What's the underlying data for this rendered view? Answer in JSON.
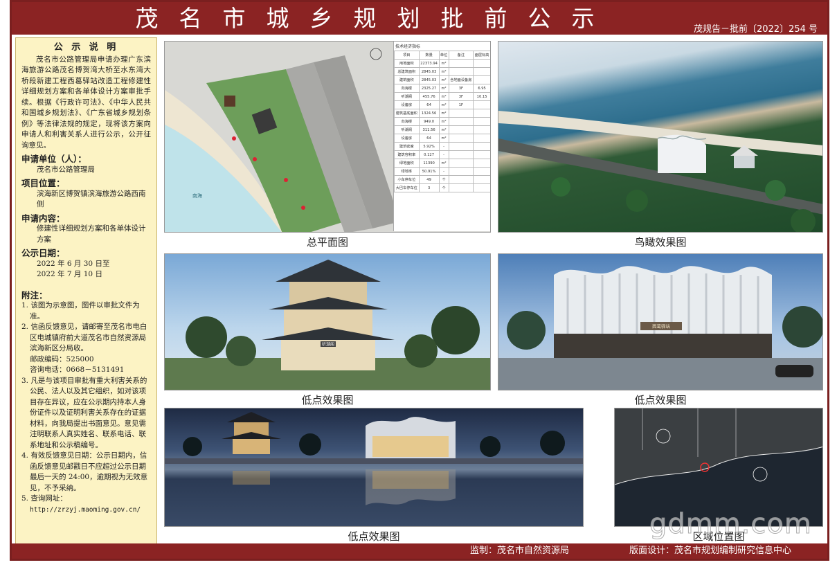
{
  "header": {
    "title": "茂名市城乡规划批前公示",
    "doc_number": "茂规告－批前〔2022〕254 号"
  },
  "notice": {
    "heading": "公 示 说 明",
    "text": "茂名市公路管理局申请办理广东滨海旅游公路茂名博贺湾大桥至水东湾大桥段新建工程西葛驿站改造工程修建性详细规划方案和各单体设计方案审批手续。根据《行政许可法》、《中华人民共和国城乡规划法》、《广东省城乡规划条例》等法律法规的规定，现将该方案向申请人和利害关系人进行公示，公开征询意见。",
    "applicant_label": "申请单位（人）：",
    "applicant": "茂名市公路管理局",
    "location_label": "项目位置：",
    "location": "滨海新区博贺镇滨海旅游公路西南侧",
    "content_label": "申请内容：",
    "content": "修建性详细规划方案和各单体设计方案",
    "date_label": "公示日期：",
    "date_from": "2022 年 6 月 30 日至",
    "date_to": "2022 年 7 月 10 日",
    "appendix_label": "附注：",
    "notes": [
      "1. 该图为示意图，图件以审批文件为准。",
      "2. 信函反馈意见，请邮寄至茂名市电白区电城镇府前大道茂名市自然资源局滨海新区分局收。",
      "邮政编码：525000",
      "咨询电话：0668－5131491",
      "3. 凡是与该项目审批有重大利害关系的公民、法人以及其它组织，如对该项目存在异议，应在公示期内持本人身份证件以及证明利害关系存在的证据材料，向我局提出书面意见。意见需注明联系人真实姓名、联系电话、联系地址和公示稿编号。",
      "4. 有效反馈意见日期：公示日期内，信函反馈意见邮戳日不应超过公示日期最后一天的 24:00，逾期视为无效意见，不予采纳。",
      "5. 查询网址：",
      "http://zrzyj.maoming.gov.cn/"
    ]
  },
  "captions": {
    "site_plan": "总平面图",
    "aerial": "鸟瞰效果图",
    "low1": "低点效果图",
    "low2": "低点效果图",
    "low3": "低点效果图",
    "location_map": "区域位置图"
  },
  "tech_table": {
    "title": "技术经济指标",
    "headers": [
      "项目",
      "数量",
      "单位",
      "备注",
      "面层标高"
    ],
    "rows": [
      [
        "用地面积",
        "22373.94",
        "m²",
        "",
        ""
      ],
      [
        "总建筑面积",
        "2845.03",
        "m²",
        "",
        ""
      ],
      [
        "建筑面积",
        "2845.03",
        "m²",
        "含地面设备房",
        ""
      ],
      [
        "向海楼",
        "2325.27",
        "m²",
        "3F",
        "6.95"
      ],
      [
        "听潮阁",
        "455.76",
        "m²",
        "3F",
        "10.15"
      ],
      [
        "设备房",
        "64",
        "m²",
        "1F",
        ""
      ],
      [
        "建筑基底面积",
        "1324.56",
        "m²",
        "",
        ""
      ],
      [
        "向海楼",
        "949.0",
        "m²",
        "",
        ""
      ],
      [
        "听潮阁",
        "311.56",
        "m²",
        "",
        ""
      ],
      [
        "设备房",
        "64",
        "m²",
        "",
        ""
      ],
      [
        "建筑密度",
        "5.92%",
        "-",
        "",
        ""
      ],
      [
        "建筑容积率",
        "0.127",
        "-",
        "",
        ""
      ],
      [
        "绿地面积",
        "11390",
        "m²",
        "",
        ""
      ],
      [
        "绿地率",
        "50.91%",
        "-",
        "",
        ""
      ],
      [
        "小车停车位",
        "49",
        "个",
        "",
        ""
      ],
      [
        "大巴车停车位",
        "3",
        "个",
        "",
        ""
      ]
    ]
  },
  "site_plan": {
    "sea_label": "南海"
  },
  "pagoda": {
    "sign": "听潮阁"
  },
  "hall": {
    "sign": "西葛驿站"
  },
  "footer": {
    "supervisor": "监制：茂名市自然资源局",
    "design": "版面设计：茂名市规划编制研究信息中心"
  },
  "watermark": "gdmm.com"
}
